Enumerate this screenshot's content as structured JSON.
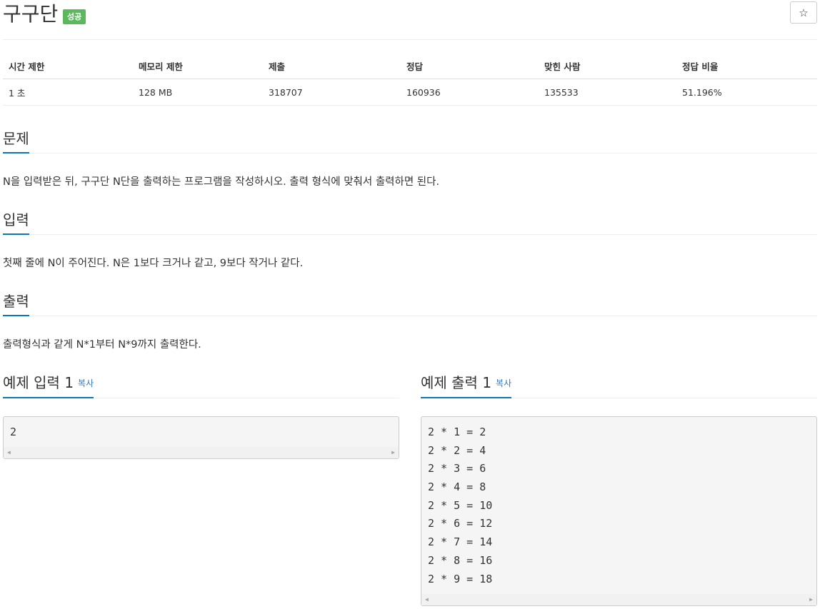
{
  "problem": {
    "title": "구구단",
    "badge": "성공",
    "star": "☆"
  },
  "info": {
    "headers": [
      "시간 제한",
      "메모리 제한",
      "제출",
      "정답",
      "맞힌 사람",
      "정답 비율"
    ],
    "values": [
      "1 초",
      "128 MB",
      "318707",
      "160936",
      "135533",
      "51.196%"
    ]
  },
  "sections": {
    "problem": {
      "title": "문제",
      "text": "N을 입력받은 뒤, 구구단 N단을 출력하는 프로그램을 작성하시오. 출력 형식에 맞춰서 출력하면 된다."
    },
    "input": {
      "title": "입력",
      "text": "첫째 줄에 N이 주어진다. N은 1보다 크거나 같고, 9보다 작거나 같다."
    },
    "output": {
      "title": "출력",
      "text": "출력형식과 같게 N*1부터 N*9까지 출력한다."
    }
  },
  "samples": {
    "input": {
      "title": "예제 입력 1",
      "copy": "복사",
      "lines": [
        "2"
      ]
    },
    "output": {
      "title": "예제 출력 1",
      "copy": "복사",
      "lines": [
        "2 * 1 = 2",
        "2 * 2 = 4",
        "2 * 3 = 6",
        "2 * 4 = 8",
        "2 * 5 = 10",
        "2 * 6 = 12",
        "2 * 7 = 14",
        "2 * 8 = 16",
        "2 * 9 = 18"
      ]
    }
  },
  "colors": {
    "accent": "#0e76b8",
    "badge": "#5cb85c",
    "link": "#337ab7"
  },
  "icons": {
    "star": "star-icon",
    "scroll_left": "scroll-left-arrow-icon",
    "scroll_right": "scroll-right-arrow-icon"
  }
}
